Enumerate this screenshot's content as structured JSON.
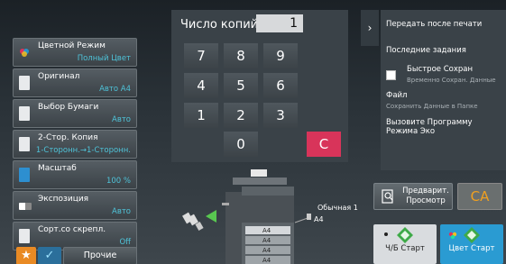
{
  "keypad": {
    "copies_label": "Число копий",
    "copies_value": "1",
    "keys": [
      "7",
      "8",
      "9",
      "4",
      "5",
      "6",
      "1",
      "2",
      "3",
      "0"
    ],
    "clear_label": "C"
  },
  "functions": [
    {
      "name": "color-mode",
      "icon": "color-mode-icon",
      "title": "Цветной Режим",
      "value": "Полный Цвет"
    },
    {
      "name": "original",
      "icon": "original-icon",
      "title": "Оригинал",
      "value": "Авто A4"
    },
    {
      "name": "paper-select",
      "icon": "paper-icon",
      "title": "Выбор Бумаги",
      "value": "Авто"
    },
    {
      "name": "duplex",
      "icon": "duplex-icon",
      "title": "2-Стор. Копия",
      "value": "1-Сторонн.→1-Сторонн."
    },
    {
      "name": "scale",
      "icon": "scale-icon",
      "title": "Масштаб",
      "value": "100 %"
    },
    {
      "name": "exposure",
      "icon": "exposure-icon",
      "title": "Экспозиция",
      "value": "Авто"
    },
    {
      "name": "staple-sort",
      "icon": "staple-icon",
      "title": "Сорт.со скрепл.",
      "value": "Off"
    }
  ],
  "bottom": {
    "star_icon": "★",
    "check_icon": "✓",
    "more_label": "Прочие"
  },
  "side": {
    "toggle_icon": "›",
    "send_after_print": "Передать после печати",
    "recent_jobs": "Последние задания",
    "quick_save": "Быстрое Сохран",
    "quick_save_sub": "Временно Сохран. Данные",
    "file": "Файл",
    "file_sub": "Сохранить Данные в Папке",
    "eco_program": "Вызовите Программу Режима Эко"
  },
  "machine": {
    "paper_label": "Обычная 1",
    "size_label": "A4",
    "tray_labels": [
      "A4",
      "A4",
      "A4",
      "A4"
    ]
  },
  "actions": {
    "preview_label": "Предварит. Просмотр",
    "ca_label": "CA",
    "bw_start": "Ч/Б Старт",
    "color_start": "Цвет Старт"
  },
  "colors": {
    "accent_value": "#4fc3d8",
    "clear_key": "#d8345a",
    "color_start": "#2a9bd2",
    "star": "#e98a24"
  }
}
